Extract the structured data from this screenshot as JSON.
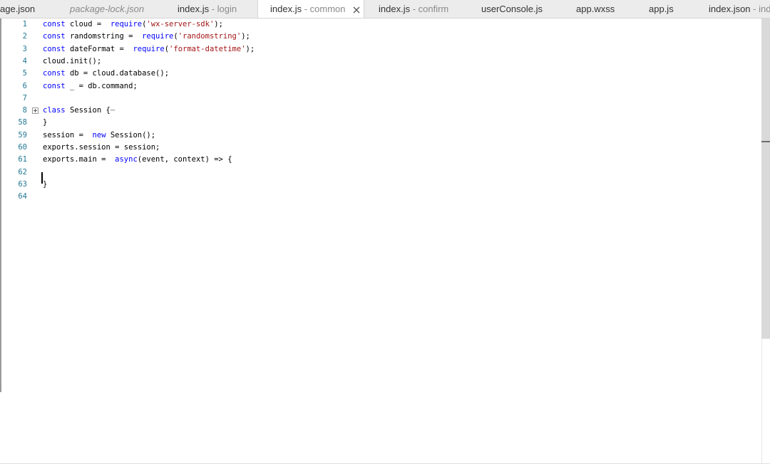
{
  "tabs": [
    {
      "name": "age.json",
      "sub": "",
      "italic": false
    },
    {
      "name": "package-lock.json",
      "sub": "",
      "italic": true
    },
    {
      "name": "index.js",
      "sub": " - login",
      "italic": false
    },
    {
      "name": "index.js",
      "sub": " - common",
      "italic": false,
      "active": true
    },
    {
      "name": "index.js",
      "sub": " - confirm",
      "italic": false
    },
    {
      "name": "userConsole.js",
      "sub": "",
      "italic": false
    },
    {
      "name": "app.wxss",
      "sub": "",
      "italic": false
    },
    {
      "name": "app.js",
      "sub": "",
      "italic": false
    },
    {
      "name": "index.json",
      "sub": " - inde",
      "italic": false
    }
  ],
  "editor": {
    "lines": [
      {
        "num": "1",
        "tokens": [
          [
            "kw",
            "const"
          ],
          [
            "",
            "cloud = "
          ],
          [
            "kw",
            "require"
          ],
          [
            "",
            "("
          ],
          [
            "str",
            "'wx-server-sdk'"
          ],
          [
            "",
            ");"
          ]
        ]
      },
      {
        "num": "2",
        "tokens": [
          [
            "kw",
            "const"
          ],
          [
            "",
            "randomstring = "
          ],
          [
            "kw",
            "require"
          ],
          [
            "",
            "("
          ],
          [
            "str",
            "'randomstring'"
          ],
          [
            "",
            ");"
          ]
        ]
      },
      {
        "num": "3",
        "tokens": [
          [
            "kw",
            "const"
          ],
          [
            "",
            "dateFormat = "
          ],
          [
            "kw",
            "require"
          ],
          [
            "",
            "("
          ],
          [
            "str",
            "'format-datetime'"
          ],
          [
            "",
            ");"
          ]
        ]
      },
      {
        "num": "4",
        "tokens": [
          [
            "",
            "cloud.init();"
          ]
        ]
      },
      {
        "num": "5",
        "tokens": [
          [
            "kw",
            "const"
          ],
          [
            "",
            "db = cloud.database();"
          ]
        ]
      },
      {
        "num": "6",
        "tokens": [
          [
            "kw",
            "const"
          ],
          [
            "",
            "_ = db.command;"
          ]
        ]
      },
      {
        "num": "7",
        "tokens": []
      },
      {
        "num": "8",
        "tokens": [
          [
            "kw",
            "class"
          ],
          [
            "",
            "Session {"
          ],
          [
            "dim",
            "⋯"
          ]
        ],
        "fold": true
      },
      {
        "num": "58",
        "tokens": [
          [
            "",
            "}"
          ]
        ]
      },
      {
        "num": "59",
        "tokens": [
          [
            "",
            "session = "
          ],
          [
            "kw",
            "new"
          ],
          [
            "",
            "Session();"
          ]
        ]
      },
      {
        "num": "60",
        "tokens": [
          [
            "",
            "exports.session = session;"
          ]
        ]
      },
      {
        "num": "61",
        "tokens": [
          [
            "",
            "exports.main = "
          ],
          [
            "kw",
            "async"
          ],
          [
            "",
            "(event, context) => {"
          ]
        ]
      },
      {
        "num": "62",
        "tokens": []
      },
      {
        "num": "63",
        "tokens": [
          [
            "",
            "}"
          ]
        ]
      },
      {
        "num": "64",
        "tokens": []
      }
    ]
  },
  "colors": {
    "keyword": "#0000ff",
    "string": "#a31515",
    "line_number": "#237893"
  },
  "icons": {
    "tab_close": "close-icon",
    "fold": "fold-expand-icon"
  }
}
